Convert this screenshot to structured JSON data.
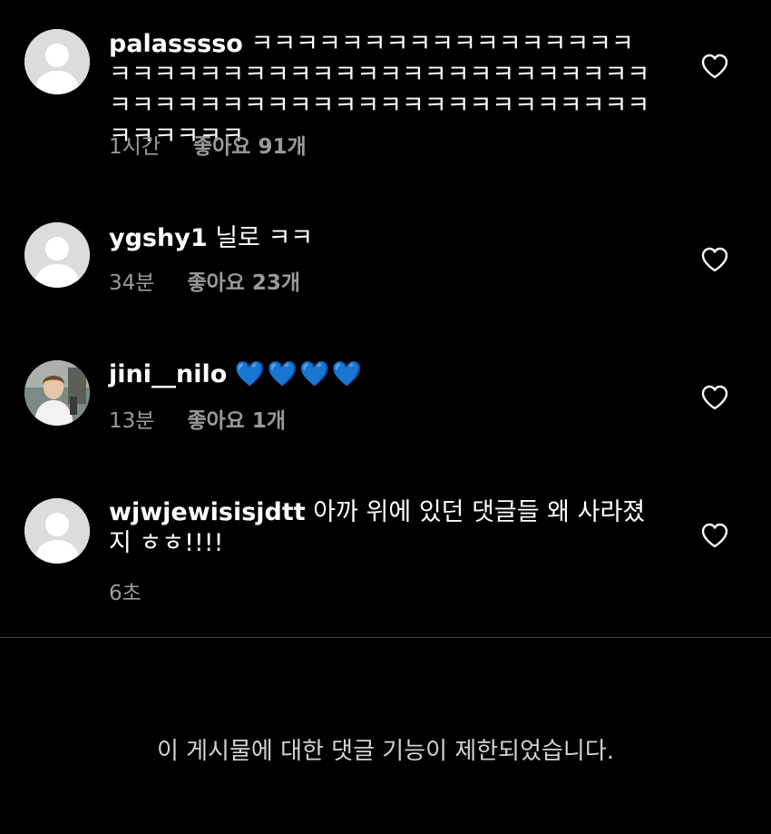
{
  "comments": [
    {
      "username": "palasssso",
      "text": "ㅋㅋㅋㅋㅋㅋㅋㅋㅋㅋㅋㅋㅋㅋㅋㅋㅋㅋㅋㅋㅋㅋㅋㅋㅋㅋㅋㅋㅋㅋㅋㅋㅋㅋㅋㅋㅋㅋㅋㅋㅋㅋㅋㅋㅋㅋㅋㅋㅋㅋㅋㅋㅋㅋㅋㅋㅋㅋㅋㅋㅋㅋㅋㅋㅋㅋㅋㅋㅋㅋㅋ",
      "time": "1시간",
      "likes": "좋아요 91개"
    },
    {
      "username": "ygshy1",
      "text": "닐로 ㅋㅋ",
      "time": "34분",
      "likes": "좋아요 23개"
    },
    {
      "username": "jini__nilo",
      "text": "💙💙💙💙",
      "time": "13분",
      "likes": "좋아요 1개"
    },
    {
      "username": "wjwjewisisjdtt",
      "text": "아까 위에 있던 댓글들 왜 사라졌지 ㅎㅎ!!!!",
      "time": "6초",
      "likes": ""
    }
  ],
  "notice": "이 게시물에 대한 댓글 기능이 제한되었습니다.",
  "icons": {
    "like": "heart-outline-icon",
    "avatar_default": "default-avatar-icon",
    "avatar_photo": "profile-photo-avatar"
  },
  "colors": {
    "background": "#000000",
    "text": "#ffffff",
    "meta": "#9a9a9a",
    "heart_emoji": "#1a8cff",
    "notice": "#d2d2d2"
  }
}
